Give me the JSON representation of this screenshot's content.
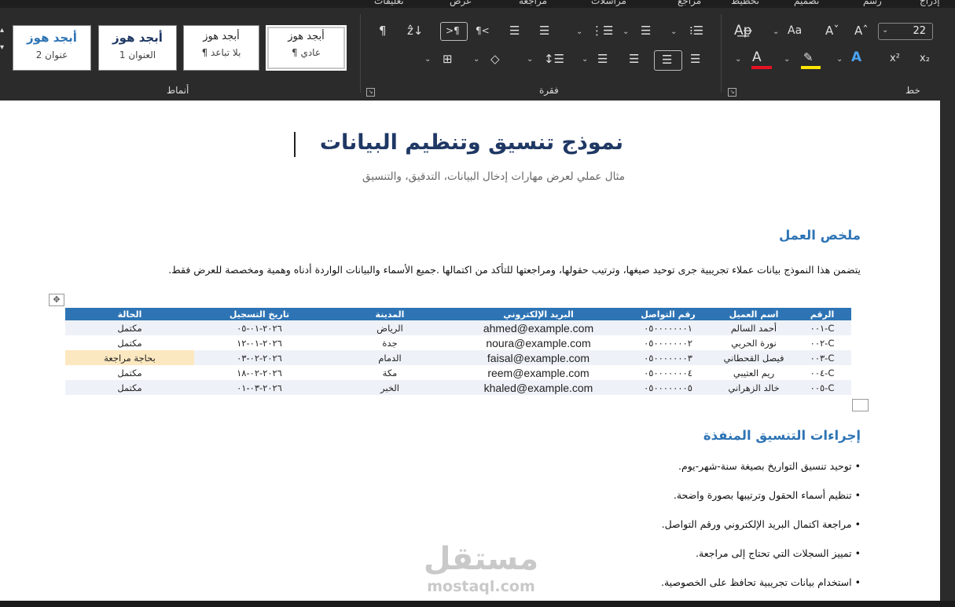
{
  "ribbon": {
    "top_tabs": [
      "تعليقات",
      "عرض",
      "مراجعة",
      "مراسلات",
      "مراجع",
      "تخطيط",
      "تصميم",
      "رسم",
      "إدراج"
    ],
    "styles_gallery": [
      {
        "sample": "أبجد هوز",
        "name": "¶ عادي",
        "selected": true
      },
      {
        "sample": "أبجد هوز",
        "name": "¶ بلا تباعد",
        "selected": false
      },
      {
        "sample": "أبجد هوز",
        "name": "العنوان 1",
        "selected": false
      },
      {
        "sample": "أبجد هوز",
        "name": "عنوان 2",
        "selected": false
      }
    ],
    "group_styles_label": "أنماط",
    "group_paragraph_label": "فقرة",
    "group_font_label": "خط",
    "font_size": "22",
    "font_color_accent": "#e81123",
    "highlight_accent": "#ffe600"
  },
  "document": {
    "title": "نموذج تنسيق وتنظيم البيانات",
    "subtitle": "مثال عملي لعرض مهارات إدخال البيانات، التدقيق، والتنسيق",
    "summary_heading": "ملخص العمل",
    "summary_text": "يتضمن هذا النموذج بيانات عملاء تجريبية جرى توحيد صيغها، وترتيب حقولها، ومراجعتها للتأكد من اكتمالها .جميع الأسماء والبيانات الواردة أدناه وهمية ومخصصة للعرض فقط.",
    "table": {
      "headers": [
        "الرقم",
        "اسم العميل",
        "رقم التواصل",
        "البريد الإلكتروني",
        "المدينة",
        "تاريخ التسجيل",
        "الحالة"
      ],
      "rows": [
        [
          "C-٠٠١",
          "أحمد السالم",
          "٠٥٠٠٠٠٠٠٠١",
          "ahmed@example.com",
          "الرياض",
          "٢٠٢٦-٠١-٠٥",
          "مكتمل"
        ],
        [
          "C-٠٠٢",
          "نورة الحربي",
          "٠٥٠٠٠٠٠٠٠٢",
          "noura@example.com",
          "جدة",
          "٢٠٢٦-٠١-١٢",
          "مكتمل"
        ],
        [
          "C-٠٠٣",
          "فيصل القحطاني",
          "٠٥٠٠٠٠٠٠٠٣",
          "faisal@example.com",
          "الدمام",
          "٢٠٢٦-٠٢-٠٣",
          "بحاجة مراجعة"
        ],
        [
          "C-٠٠٤",
          "ريم العتيبي",
          "٠٥٠٠٠٠٠٠٠٤",
          "reem@example.com",
          "مكة",
          "٢٠٢٦-٠٢-١٨",
          "مكتمل"
        ],
        [
          "C-٠٠٥",
          "خالد الزهراني",
          "٠٥٠٠٠٠٠٠٠٥",
          "khaled@example.com",
          "الخبر",
          "٢٠٢٦-٠٣-٠١",
          "مكتمل"
        ]
      ],
      "header_color": "#2e74b5",
      "review_highlight": "#fce8c0"
    },
    "actions_heading": "إجراءات التنسيق المنفذة",
    "actions": [
      "توحيد تنسيق التواريخ بصيغة سنة-شهر-يوم.",
      "تنظيم أسماء الحقول وترتيبها بصورة واضحة.",
      "مراجعة اكتمال البريد الإلكتروني ورقم التواصل.",
      "تمييز السجلات التي تحتاج إلى مراجعة.",
      "استخدام بيانات تجريبية تحافظ على الخصوصية."
    ]
  },
  "watermark": {
    "arabic": "مستقل",
    "latin": "mostaql.com"
  }
}
